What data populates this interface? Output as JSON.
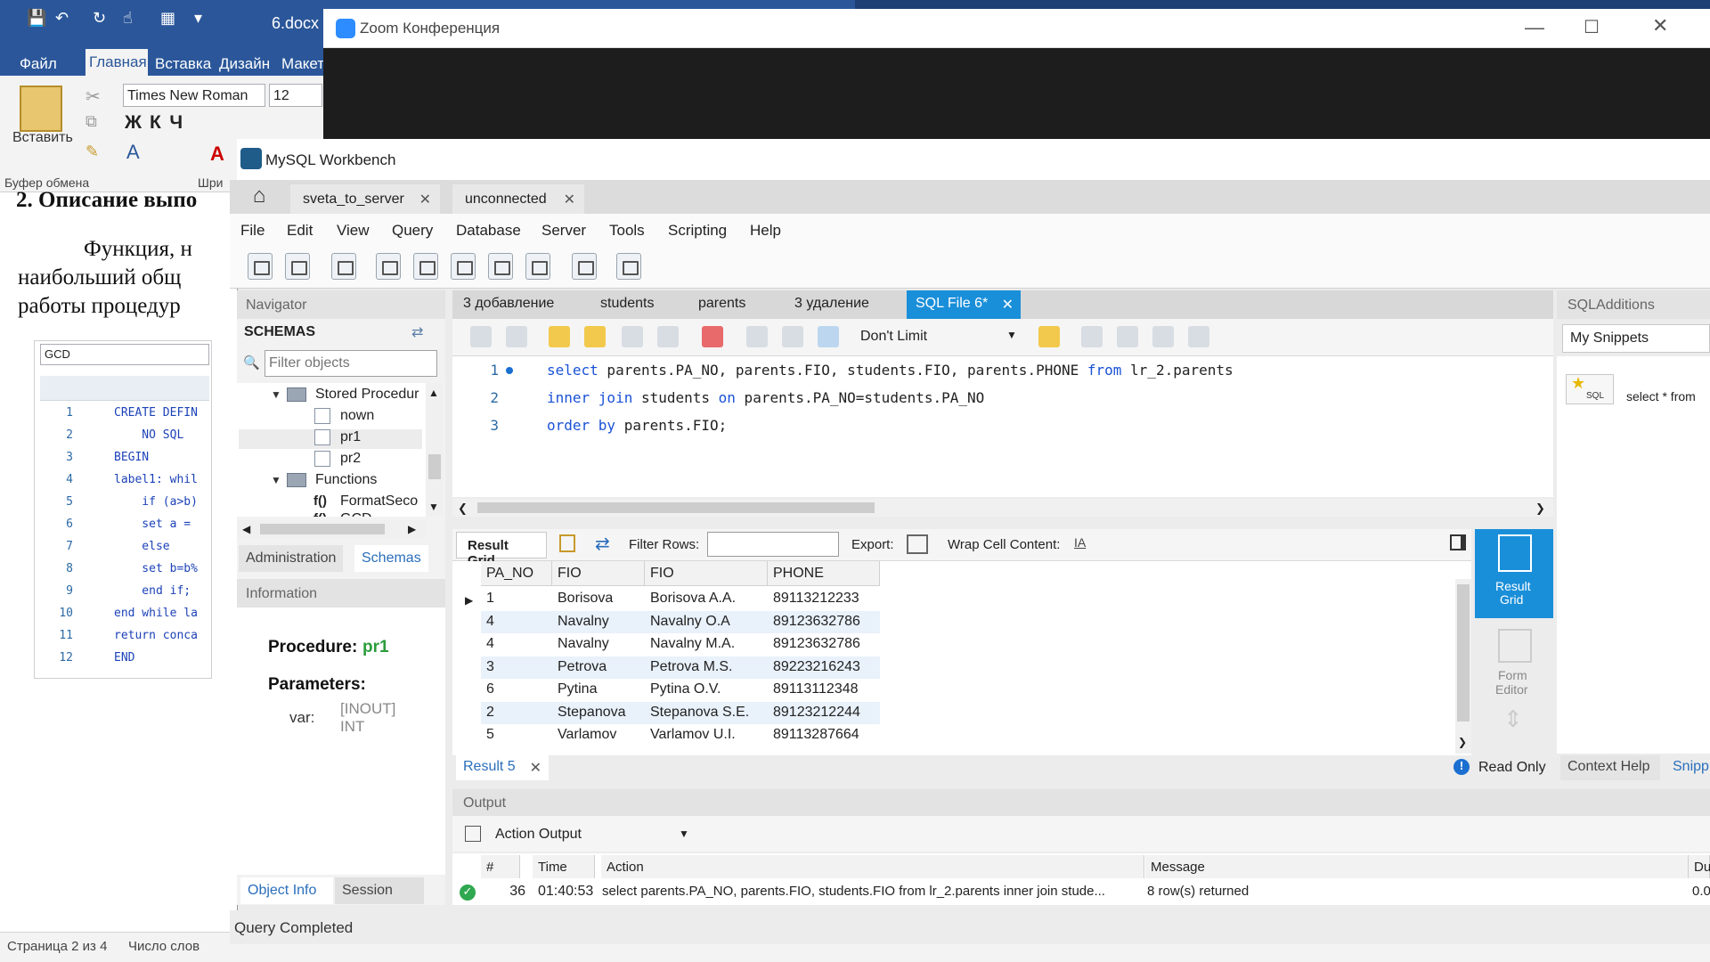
{
  "word": {
    "doc_name": "6.docx",
    "tabs": [
      "Файл",
      "Главная",
      "Вставка",
      "Дизайн",
      "Макет"
    ],
    "paste_label": "Вставить",
    "font_name": "Times New Roman",
    "font_size": "12",
    "clipboard_group": "Буфер обмена",
    "font_group": "Шри",
    "heading": "2.  Описание выпо",
    "para1": "Функция,  н",
    "para2": "наибольший  общ",
    "para3": "работы процедур",
    "embedded": {
      "search_value": "GCD",
      "lines": [
        {
          "n": "1",
          "code": "CREATE DEFIN"
        },
        {
          "n": "2",
          "code": "    NO SQL"
        },
        {
          "n": "3",
          "code": "BEGIN"
        },
        {
          "n": "4",
          "code": "label1: whil"
        },
        {
          "n": "5",
          "code": "    if (a>b)"
        },
        {
          "n": "6",
          "code": "    set a ="
        },
        {
          "n": "7",
          "code": "    else"
        },
        {
          "n": "8",
          "code": "    set b=b%"
        },
        {
          "n": "9",
          "code": "    end if;"
        },
        {
          "n": "10",
          "code": "end while la"
        },
        {
          "n": "11",
          "code": "return conca"
        },
        {
          "n": "12",
          "code": "END"
        }
      ]
    },
    "status_page": "Страница 2 из 4",
    "status_words": "Число слов"
  },
  "zoom": {
    "title": "Zoom Конференция"
  },
  "workbench": {
    "title": "MySQL Workbench",
    "connection_tabs": [
      "sveta_to_server",
      "unconnected"
    ],
    "menu": [
      "File",
      "Edit",
      "View",
      "Query",
      "Database",
      "Server",
      "Tools",
      "Scripting",
      "Help"
    ],
    "navigator": {
      "header": "Navigator",
      "schemas_label": "SCHEMAS",
      "filter_placeholder": "Filter objects",
      "tree": {
        "stored_procedures": "Stored Procedur",
        "procs": [
          "nown",
          "pr1",
          "pr2"
        ],
        "functions": "Functions",
        "func_prefix": "f()",
        "funcs": [
          "FormatSeco",
          "GCD"
        ]
      },
      "tab_admin": "Administration",
      "tab_schemas": "Schemas",
      "info_header": "Information",
      "procedure_label": "Procedure:",
      "procedure_name": "pr1",
      "parameters_label": "Parameters:",
      "param_name": "var:",
      "param_type_line1": "[INOUT]",
      "param_type_line2": "INT",
      "tab_object_info": "Object Info",
      "tab_session": "Session"
    },
    "editor": {
      "tabs": [
        "3 добавление",
        "students",
        "parents",
        "3 удаление"
      ],
      "active_tab": "SQL File 6*",
      "limit": "Don't Limit",
      "lines": [
        {
          "n": "1",
          "kw1": "select",
          "rest1": " parents.PA_NO, parents.FIO, students.FIO, parents.PHONE ",
          "kw2": "from",
          "rest2": " lr_2.parents"
        },
        {
          "n": "2",
          "kw1": "inner join",
          "rest1": " students ",
          "kw2": "on",
          "rest2": " parents.PA_NO=students.PA_NO"
        },
        {
          "n": "3",
          "kw1": "order by",
          "rest1": " parents.FIO;",
          "kw2": "",
          "rest2": ""
        }
      ]
    },
    "results": {
      "grid_label": "Result Grid",
      "filter_label": "Filter Rows:",
      "export_label": "Export:",
      "wrap_label": "Wrap Cell Content:",
      "columns": [
        "PA_NO",
        "FIO",
        "FIO",
        "PHONE"
      ],
      "rows": [
        [
          "1",
          "Borisova",
          "Borisova A.A.",
          "89113212233"
        ],
        [
          "4",
          "Navalny",
          "Navalny O.A",
          "89123632786"
        ],
        [
          "4",
          "Navalny",
          "Navalny M.A.",
          "89123632786"
        ],
        [
          "3",
          "Petrova",
          "Petrova M.S.",
          "89223216243"
        ],
        [
          "6",
          "Pytina",
          "Pytina O.V.",
          "89113112348"
        ],
        [
          "2",
          "Stepanova",
          "Stepanova S.E.",
          "89123212244"
        ],
        [
          "5",
          "Varlamov",
          "Varlamov U.I.",
          "89113287664"
        ]
      ],
      "side_grid_line1": "Result",
      "side_grid_line2": "Grid",
      "side_form_line1": "Form",
      "side_form_line2": "Editor",
      "result_tab": "Result 5",
      "read_only": "Read Only"
    },
    "additions": {
      "header": "SQLAdditions",
      "snippets_select": "My Snippets",
      "snippet_icon_label": "SQL",
      "snippet_text": "select * from",
      "tab_context_help": "Context Help",
      "tab_snippets": "Snipp"
    },
    "output": {
      "header": "Output",
      "selector": "Action Output",
      "columns": [
        "#",
        "Time",
        "Action",
        "Message",
        "Du"
      ],
      "row": {
        "num": "36",
        "time": "01:40:53",
        "action": "select parents.PA_NO, parents.FIO, students.FIO from lr_2.parents inner join stude...",
        "message": "8 row(s) returned",
        "duration": "0.0"
      }
    },
    "status": "Query Completed"
  }
}
